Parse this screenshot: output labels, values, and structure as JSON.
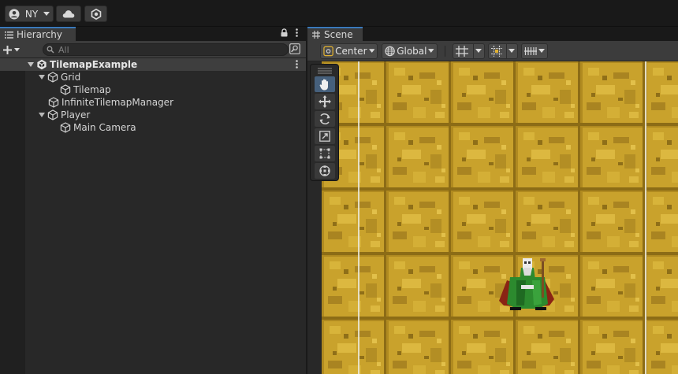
{
  "toolbar": {
    "account_label": "NY",
    "account_icon": "account-circle-icon",
    "cloud_icon": "cloud-icon",
    "collab_icon": "collab-hexagon-icon"
  },
  "hierarchy": {
    "tab_label": "Hierarchy",
    "search_placeholder": "All",
    "scene": "TilemapExample",
    "items": [
      {
        "label": "Grid",
        "depth": 1,
        "expanded": true
      },
      {
        "label": "Tilemap",
        "depth": 2,
        "expanded": null
      },
      {
        "label": "InfiniteTilemapManager",
        "depth": 1,
        "expanded": null
      },
      {
        "label": "Player",
        "depth": 1,
        "expanded": true
      },
      {
        "label": "Main Camera",
        "depth": 2,
        "expanded": null
      }
    ]
  },
  "scene": {
    "tab_label": "Scene",
    "pivot_label": "Center",
    "space_label": "Global",
    "tools": [
      {
        "name": "hand-tool",
        "icon": "hand-icon",
        "active": true
      },
      {
        "name": "move-tool",
        "icon": "move-arrows-icon",
        "active": false
      },
      {
        "name": "rotate-tool",
        "icon": "rotate-icon",
        "active": false
      },
      {
        "name": "scale-tool",
        "icon": "scale-icon",
        "active": false
      },
      {
        "name": "rect-tool",
        "icon": "rect-icon",
        "active": false
      },
      {
        "name": "transform-tool",
        "icon": "transform-icon",
        "active": false
      }
    ]
  },
  "colors": {
    "accent": "#3a79bb",
    "panel": "#282828",
    "toolbar": "#3c3c3c",
    "sand": "#c9a22c",
    "sand_dark": "#a68222",
    "robe_green": "#2c8a2e",
    "cape_red": "#8a2414"
  }
}
